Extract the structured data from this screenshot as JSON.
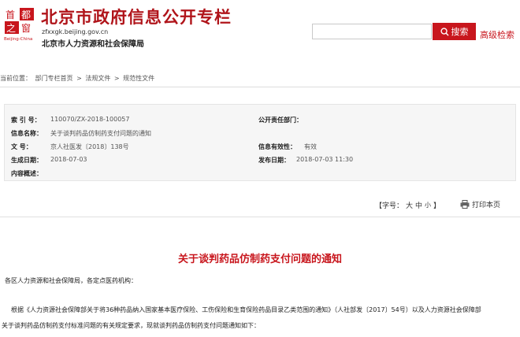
{
  "header": {
    "logo_text": [
      "首",
      "都",
      "之",
      "窗",
      "Beijing-China"
    ],
    "title": "北京市政府信息公开专栏",
    "url": "zfxxgk.beijing.gov.cn",
    "org": "北京市人力资源和社会保障局",
    "search_placeholder": "",
    "search_label": "搜索",
    "advanced_search": "高级检索"
  },
  "breadcrumb": {
    "prefix": "当前位置：",
    "items": [
      "部门专栏首页",
      "法规文件",
      "规范性文件"
    ],
    "separator": ">"
  },
  "meta": {
    "index_label": "索 引 号：",
    "index_value": "110070/ZX-2018-100057",
    "owner_label": "公开责任部门：",
    "owner_value": "",
    "name_label": "信息名称：",
    "name_value": "关于谈判药品仿制药支付问题的通知",
    "doc_label": "文 号：",
    "doc_value": "京人社医发〔2018〕138号",
    "validity_label": "信息有效性：",
    "validity_value": "有效",
    "created_label": "生成日期：",
    "created_value": "2018-07-03",
    "published_label": "发布日期：",
    "published_value": "2018-07-03 11:30",
    "summary_label": "内容概述：",
    "summary_value": ""
  },
  "toolbar": {
    "font_label": "【字号：",
    "large": "大",
    "medium": "中",
    "small": "小",
    "close": "】",
    "print": "打印本页"
  },
  "article": {
    "title": "关于谈判药品仿制药支付问题的通知",
    "greeting": "各区人力资源和社会保障局，各定点医药机构：",
    "para1": "根据《人力资源社会保障部关于将36种药品纳入国家基本医疗保险、工伤保险和生育保险药品目录乙类范围的通知》（人社部发〔2017〕54号）以及人力资源社会保障部",
    "para2": "关于谈判药品仿制药支付标准问题的有关规定要求，现就谈判药品仿制药支付问题通知如下："
  },
  "colors": {
    "brand_red": "#c8161d",
    "title_red": "#b0141a"
  }
}
